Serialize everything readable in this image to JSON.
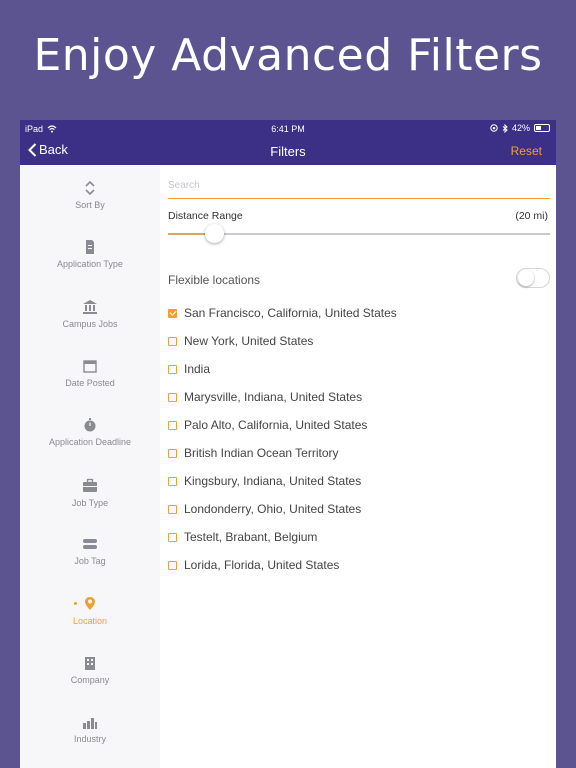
{
  "headline": "Enjoy Advanced Filters",
  "status": {
    "device": "iPad",
    "time": "6:41 PM",
    "battery": "42%"
  },
  "nav": {
    "back_label": "Back",
    "title": "Filters",
    "reset_label": "Reset"
  },
  "sidebar": {
    "items": [
      {
        "label": "Sort By",
        "icon": "sort-icon"
      },
      {
        "label": "Application Type",
        "icon": "document-icon"
      },
      {
        "label": "Campus Jobs",
        "icon": "campus-icon"
      },
      {
        "label": "Date Posted",
        "icon": "calendar-icon"
      },
      {
        "label": "Application Deadline",
        "icon": "stopwatch-icon"
      },
      {
        "label": "Job Type",
        "icon": "briefcase-icon"
      },
      {
        "label": "Job Tag",
        "icon": "tag-icon"
      },
      {
        "label": "Location",
        "icon": "location-pin-icon",
        "active": true
      },
      {
        "label": "Company",
        "icon": "building-icon"
      },
      {
        "label": "Industry",
        "icon": "industry-icon"
      }
    ]
  },
  "filters": {
    "search_placeholder": "Search",
    "distance_label": "Distance Range",
    "distance_value": "(20 mi)",
    "distance_fraction": 0.12,
    "flexible_label": "Flexible locations",
    "flexible_on": false
  },
  "locations": [
    {
      "name": "San Francisco, California, United States",
      "checked": true
    },
    {
      "name": "New York, United States",
      "checked": false
    },
    {
      "name": "India",
      "checked": false
    },
    {
      "name": "Marysville, Indiana, United States",
      "checked": false
    },
    {
      "name": "Palo Alto, California, United States",
      "checked": false
    },
    {
      "name": "British Indian Ocean Territory",
      "checked": false
    },
    {
      "name": "Kingsbury, Indiana, United States",
      "checked": false
    },
    {
      "name": "Londonderry, Ohio, United States",
      "checked": false
    },
    {
      "name": "Testelt, Brabant, Belgium",
      "checked": false
    },
    {
      "name": "Lorida, Florida, United States",
      "checked": false
    }
  ],
  "colors": {
    "background": "#5b5491",
    "navbar": "#3c2f86",
    "accent": "#f0a030"
  }
}
